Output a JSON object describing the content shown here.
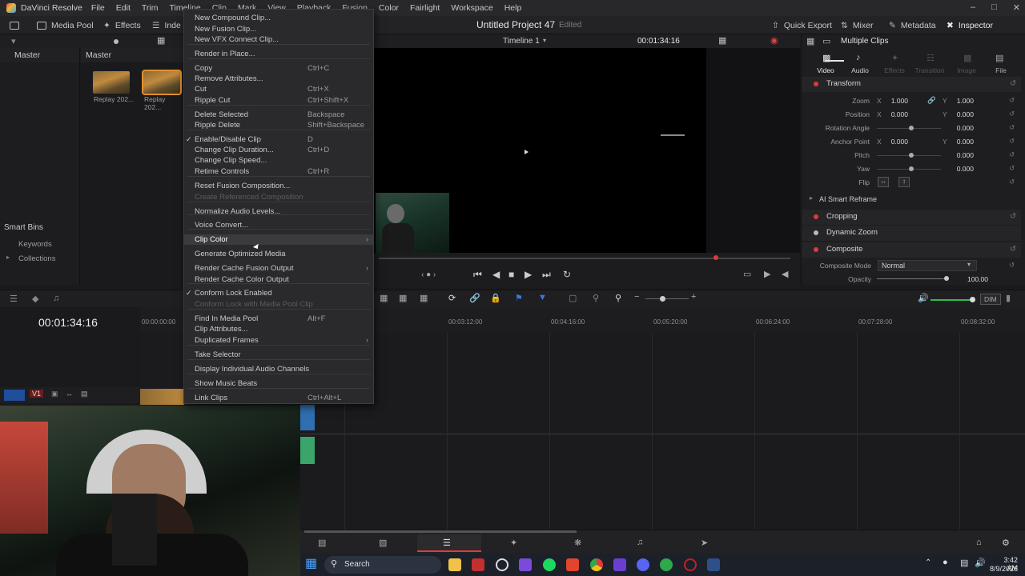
{
  "app": {
    "name": "DaVinci Resolve",
    "menus": [
      "File",
      "Edit",
      "Trim",
      "Timeline",
      "Clip",
      "Mark",
      "View",
      "Playback",
      "Fusion",
      "Color",
      "Fairlight",
      "Workspace",
      "Help"
    ]
  },
  "toolbar": {
    "media_pool": "Media Pool",
    "effects": "Effects",
    "index": "Inde",
    "project_title": "Untitled Project 47",
    "edited": "Edited",
    "quick_export": "Quick Export",
    "mixer": "Mixer",
    "metadata": "Metadata",
    "inspector": "Inspector"
  },
  "viewer": {
    "timeline_name": "Timeline 1",
    "timecode": "00:01:34:16"
  },
  "bins": {
    "master": "Master",
    "smart_bins": "Smart Bins",
    "keywords": "Keywords",
    "collections": "Collections"
  },
  "mediapool": {
    "header": "Master",
    "clips": [
      {
        "label": "Replay 202..."
      },
      {
        "label": "Replay 202..."
      }
    ]
  },
  "inspector": {
    "title": "Multiple Clips",
    "tabs": [
      "Video",
      "Audio",
      "Effects",
      "Transition",
      "Image",
      "File"
    ],
    "transform": {
      "title": "Transform",
      "zoom_label": "Zoom",
      "zoom_x": "1.000",
      "zoom_y": "1.000",
      "position_label": "Position",
      "position_x": "0.000",
      "position_y": "0.000",
      "rotation_label": "Rotation Angle",
      "rotation": "0.000",
      "anchor_label": "Anchor Point",
      "anchor_x": "0.000",
      "anchor_y": "0.000",
      "pitch_label": "Pitch",
      "pitch": "0.000",
      "yaw_label": "Yaw",
      "yaw": "0.000",
      "flip_label": "Flip"
    },
    "ai_smart_reframe": "AI Smart Reframe",
    "cropping": "Cropping",
    "dynamic_zoom": "Dynamic Zoom",
    "composite": {
      "title": "Composite",
      "mode_label": "Composite Mode",
      "mode": "Normal",
      "opacity_label": "Opacity",
      "opacity": "100.00"
    }
  },
  "timeline": {
    "timecode": "00:01:34:16",
    "track": "V1",
    "dim": "DIM",
    "ruler": [
      "00:00:00:00",
      "00:03:12:00",
      "00:04:16:00",
      "00:05:20:00",
      "00:06:24:00",
      "00:07:28:00",
      "00:08:32:00"
    ]
  },
  "context_menu": {
    "items": [
      {
        "label": "New Compound Clip...",
        "key": "",
        "disabled": false
      },
      {
        "label": "New Fusion Clip...",
        "key": "",
        "disabled": false
      },
      {
        "label": "New VFX Connect Clip...",
        "key": "",
        "disabled": false
      },
      {
        "label": "Render in Place...",
        "key": "",
        "disabled": false
      },
      {
        "label": "Copy",
        "key": "Ctrl+C",
        "disabled": false
      },
      {
        "label": "Remove Attributes...",
        "key": "",
        "disabled": false
      },
      {
        "label": "Cut",
        "key": "Ctrl+X",
        "disabled": false
      },
      {
        "label": "Ripple Cut",
        "key": "Ctrl+Shift+X",
        "disabled": false
      },
      {
        "label": "Delete Selected",
        "key": "Backspace",
        "disabled": false
      },
      {
        "label": "Ripple Delete",
        "key": "Shift+Backspace",
        "disabled": false
      },
      {
        "label": "Enable/Disable Clip",
        "key": "D",
        "disabled": false,
        "checked": true
      },
      {
        "label": "Change Clip Duration...",
        "key": "Ctrl+D",
        "disabled": false
      },
      {
        "label": "Change Clip Speed...",
        "key": "",
        "disabled": false
      },
      {
        "label": "Retime Controls",
        "key": "Ctrl+R",
        "disabled": false
      },
      {
        "label": "Reset Fusion Composition...",
        "key": "",
        "disabled": false
      },
      {
        "label": "Create Referenced Composition",
        "key": "",
        "disabled": true
      },
      {
        "label": "Normalize Audio Levels...",
        "key": "",
        "disabled": false
      },
      {
        "label": "Voice Convert...",
        "key": "",
        "disabled": false
      },
      {
        "label": "Clip Color",
        "key": "",
        "disabled": false,
        "submenu": true
      },
      {
        "label": "Generate Optimized Media",
        "key": "",
        "disabled": false
      },
      {
        "label": "Render Cache Fusion Output",
        "key": "",
        "disabled": false,
        "submenu": true
      },
      {
        "label": "Render Cache Color Output",
        "key": "",
        "disabled": false
      },
      {
        "label": "Conform Lock Enabled",
        "key": "",
        "disabled": false,
        "checked": true
      },
      {
        "label": "Conform Lock with Media Pool Clip",
        "key": "",
        "disabled": true
      },
      {
        "label": "Find In Media Pool",
        "key": "Alt+F",
        "disabled": false
      },
      {
        "label": "Clip Attributes...",
        "key": "",
        "disabled": false
      },
      {
        "label": "Duplicated Frames",
        "key": "",
        "disabled": false,
        "submenu": true
      },
      {
        "label": "Take Selector",
        "key": "",
        "disabled": false
      },
      {
        "label": "Display Individual Audio Channels",
        "key": "",
        "disabled": false
      },
      {
        "label": "Show Music Beats",
        "key": "",
        "disabled": false
      },
      {
        "label": "Link Clips",
        "key": "Ctrl+Alt+L",
        "disabled": false
      }
    ]
  },
  "taskbar": {
    "search": "Search",
    "time": "3:42 AM",
    "date": "8/9/2026"
  }
}
